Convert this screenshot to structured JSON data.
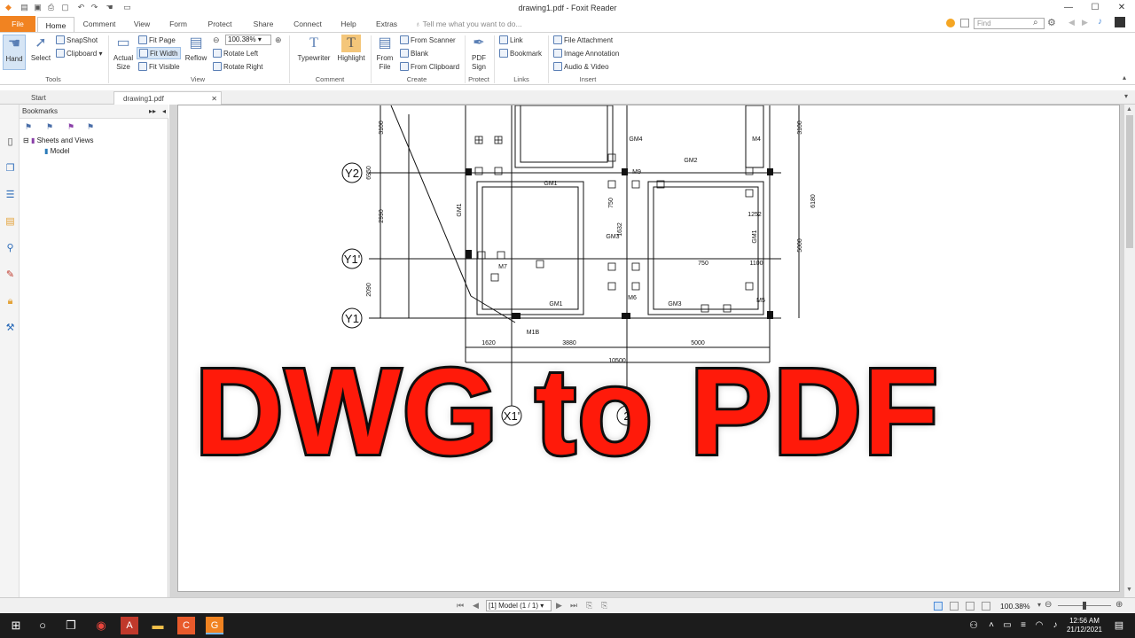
{
  "window": {
    "title": "drawing1.pdf - Foxit Reader"
  },
  "menu_tabs": [
    "File",
    "Home",
    "Comment",
    "View",
    "Form",
    "Protect",
    "Share",
    "Connect",
    "Help",
    "Extras"
  ],
  "tell_me": "Tell me what you want to do...",
  "find_placeholder": "Find",
  "ribbon": {
    "tools": {
      "hand": "Hand",
      "select": "Select",
      "snapshot": "SnapShot",
      "clipboard": "Clipboard",
      "label": "Tools"
    },
    "view": {
      "actual_size_1": "Actual",
      "actual_size_2": "Size",
      "fit_page": "Fit Page",
      "fit_width": "Fit Width",
      "fit_visible": "Fit Visible",
      "reflow": "Reflow",
      "zoom": "100.38%",
      "rotate_left": "Rotate Left",
      "rotate_right": "Rotate Right",
      "label": "View"
    },
    "comment": {
      "typewriter": "Typewriter",
      "highlight": "Highlight",
      "label": "Comment"
    },
    "create": {
      "from_file_1": "From",
      "from_file_2": "File",
      "from_scanner": "From Scanner",
      "blank": "Blank",
      "from_clipboard": "From Clipboard",
      "label": "Create"
    },
    "protect": {
      "pdf_sign_1": "PDF",
      "pdf_sign_2": "Sign",
      "label": "Protect"
    },
    "links": {
      "link": "Link",
      "bookmark": "Bookmark",
      "label": "Links"
    },
    "insert": {
      "file_attachment": "File Attachment",
      "image_annotation": "Image Annotation",
      "audio_video": "Audio & Video",
      "label": "Insert"
    }
  },
  "doc_tabs": [
    "Start",
    "drawing1.pdf"
  ],
  "bookmarks": {
    "header": "Bookmarks",
    "items": [
      "Sheets and Views",
      "Model"
    ]
  },
  "drawing": {
    "axes_y": [
      "Y2",
      "Y1'",
      "Y1"
    ],
    "axes_x": [
      "X1'",
      "2"
    ],
    "dims_bottom": [
      "1620",
      "3880",
      "5000"
    ],
    "dim_total": "10500",
    "dims_left": [
      "3100",
      "6950",
      "2990",
      "2090"
    ],
    "dims_right": [
      "3100",
      "6180",
      "5000"
    ],
    "labels": [
      "GM4",
      "M4",
      "GM2",
      "M9",
      "GM1",
      "GM1",
      "GM3",
      "GM1",
      "M7",
      "M6",
      "GM1",
      "GM3",
      "M5",
      "M1B",
      "1632",
      "1252",
      "750",
      "750",
      "1100"
    ]
  },
  "overlay_text": "DWG to PDF",
  "status": {
    "page": "[1] Model (1 / 1)",
    "zoom": "100.38%"
  },
  "taskbar": {
    "time": "12:56 AM",
    "date": "21/12/2021"
  }
}
